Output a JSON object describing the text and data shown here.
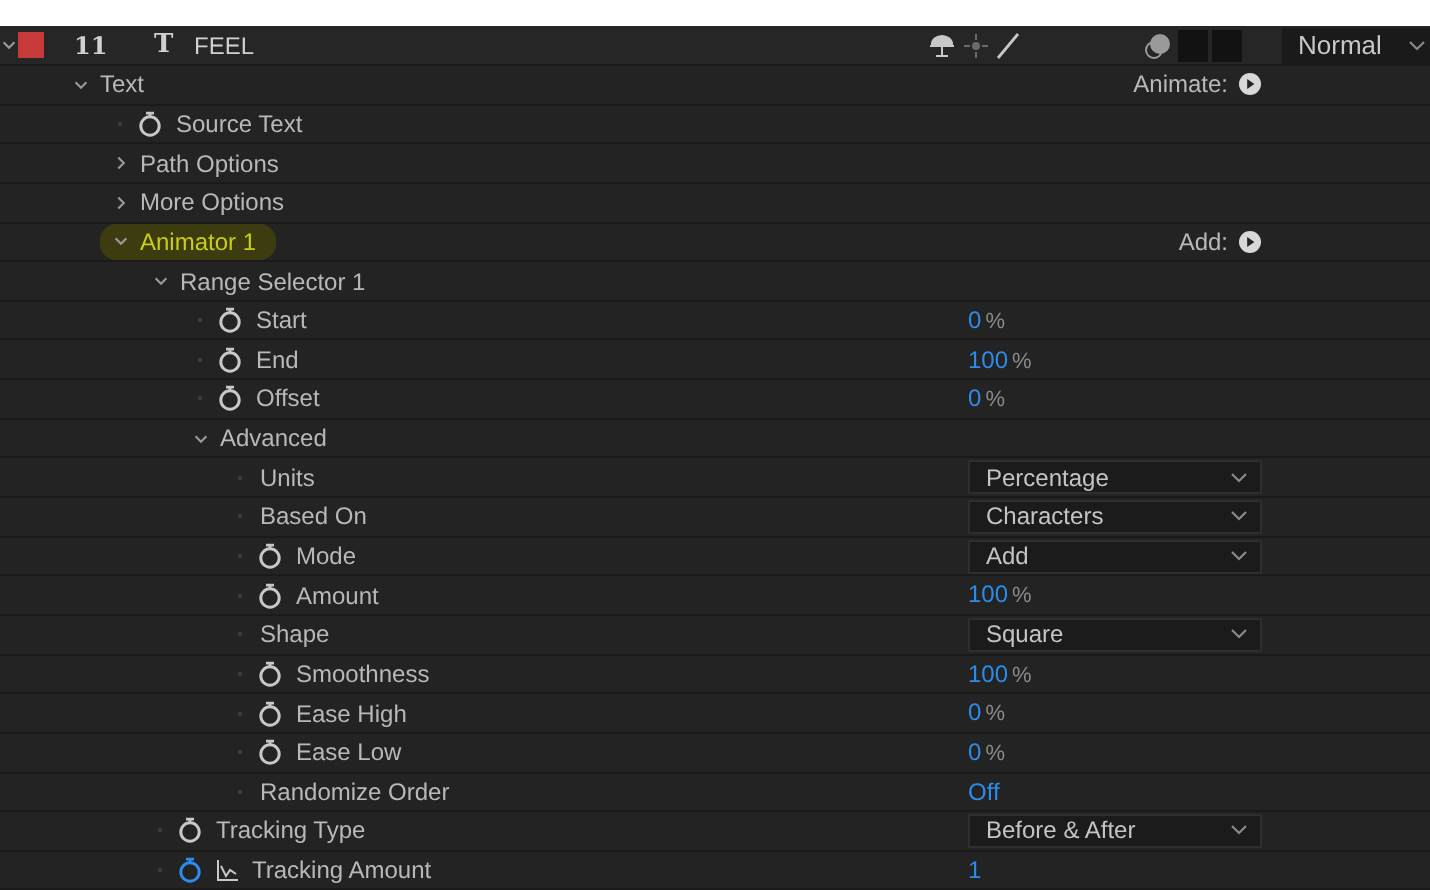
{
  "layer": {
    "expanded": true,
    "color": "#c83a3a",
    "number": "11",
    "type_glyph": "T",
    "name": "FEEL",
    "blend_mode": "Normal"
  },
  "properties": [
    {
      "kind": "group",
      "label": "Text",
      "expanded": true,
      "action": "Animate:",
      "children": [
        {
          "kind": "property",
          "label": "Source Text"
        },
        {
          "kind": "group",
          "label": "Path Options",
          "expanded": false
        },
        {
          "kind": "group",
          "label": "More Options",
          "expanded": false
        },
        {
          "kind": "group",
          "label": "Animator 1",
          "expanded": true,
          "highlighted": true,
          "action": "Add:",
          "children": [
            {
              "kind": "group",
              "label": "Range Selector 1",
              "expanded": true,
              "children": [
                {
                  "kind": "property",
                  "label": "Start",
                  "value": {
                    "kind": "number",
                    "number": "0",
                    "unit": "%"
                  }
                },
                {
                  "kind": "property",
                  "label": "End",
                  "value": {
                    "kind": "number",
                    "number": "100",
                    "unit": "%"
                  }
                },
                {
                  "kind": "property",
                  "label": "Offset",
                  "value": {
                    "kind": "number",
                    "number": "0",
                    "unit": "%"
                  }
                },
                {
                  "kind": "group",
                  "label": "Advanced",
                  "expanded": true,
                  "children": [
                    {
                      "kind": "plain",
                      "label": "Units",
                      "value": {
                        "kind": "dropdown",
                        "text": "Percentage"
                      }
                    },
                    {
                      "kind": "plain",
                      "label": "Based On",
                      "value": {
                        "kind": "dropdown",
                        "text": "Characters"
                      }
                    },
                    {
                      "kind": "property",
                      "label": "Mode",
                      "value": {
                        "kind": "dropdown",
                        "text": "Add"
                      }
                    },
                    {
                      "kind": "property",
                      "label": "Amount",
                      "value": {
                        "kind": "number",
                        "number": "100",
                        "unit": "%"
                      }
                    },
                    {
                      "kind": "plain",
                      "label": "Shape",
                      "value": {
                        "kind": "dropdown",
                        "text": "Square"
                      }
                    },
                    {
                      "kind": "property",
                      "label": "Smoothness",
                      "value": {
                        "kind": "number",
                        "number": "100",
                        "unit": "%"
                      }
                    },
                    {
                      "kind": "property",
                      "label": "Ease High",
                      "value": {
                        "kind": "number",
                        "number": "0",
                        "unit": "%"
                      }
                    },
                    {
                      "kind": "property",
                      "label": "Ease Low",
                      "value": {
                        "kind": "number",
                        "number": "0",
                        "unit": "%"
                      }
                    },
                    {
                      "kind": "plain",
                      "label": "Randomize Order",
                      "value": {
                        "kind": "text",
                        "text": "Off"
                      }
                    }
                  ]
                }
              ]
            },
            {
              "kind": "property",
              "label": "Tracking Type",
              "value": {
                "kind": "dropdown",
                "text": "Before & After"
              }
            },
            {
              "kind": "property",
              "label": "Tracking Amount",
              "keyframed": true,
              "value": {
                "kind": "number",
                "number": "1"
              }
            }
          ]
        }
      ]
    }
  ]
}
